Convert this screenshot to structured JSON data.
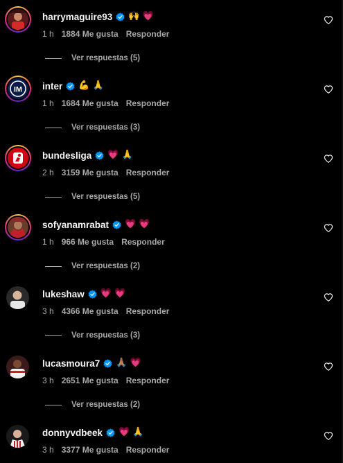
{
  "colors": {
    "background": "#000000",
    "text": "#f5f5f5",
    "muted": "#a8a8a8",
    "verified": "#0095f6",
    "heart_emoji": "#ff3b6b"
  },
  "labels": {
    "reply": "Responder"
  },
  "comments": [
    {
      "username": "harrymaguire93",
      "verified": true,
      "text": "🙌 💗",
      "time": "1 h",
      "likes": "1884 Me gusta",
      "reply": "Responder",
      "replies": "Ver respuestas (5)",
      "avatar": "maguire-avatar",
      "story_ring": true
    },
    {
      "username": "inter",
      "verified": true,
      "text": "💪 🙏",
      "time": "1 h",
      "likes": "1684 Me gusta",
      "reply": "Responder",
      "replies": "Ver respuestas (3)",
      "avatar": "inter-logo",
      "story_ring": true
    },
    {
      "username": "bundesliga",
      "verified": true,
      "text": "💗 🙏",
      "time": "2 h",
      "likes": "3159 Me gusta",
      "reply": "Responder",
      "replies": "Ver respuestas (5)",
      "avatar": "bundesliga-logo",
      "story_ring": true
    },
    {
      "username": "sofyanamrabat",
      "verified": true,
      "text": "💗 💗",
      "time": "1 h",
      "likes": "966 Me gusta",
      "reply": "Responder",
      "replies": "Ver respuestas (2)",
      "avatar": "amrabat-avatar",
      "story_ring": true
    },
    {
      "username": "lukeshaw",
      "verified": true,
      "text": "💗 💗",
      "time": "3 h",
      "likes": "4366 Me gusta",
      "reply": "Responder",
      "replies": "Ver respuestas (3)",
      "avatar": "shaw-avatar",
      "story_ring": false
    },
    {
      "username": "lucasmoura7",
      "verified": true,
      "text": "🙏🏽 💗",
      "time": "3 h",
      "likes": "2651 Me gusta",
      "reply": "Responder",
      "replies": "Ver respuestas (2)",
      "avatar": "moura-avatar",
      "story_ring": false
    },
    {
      "username": "donnyvdbeek",
      "verified": true,
      "text": "💗 🙏",
      "time": "3 h",
      "likes": "3377 Me gusta",
      "reply": "Responder",
      "replies": "",
      "avatar": "vdbeek-avatar",
      "story_ring": false
    }
  ]
}
